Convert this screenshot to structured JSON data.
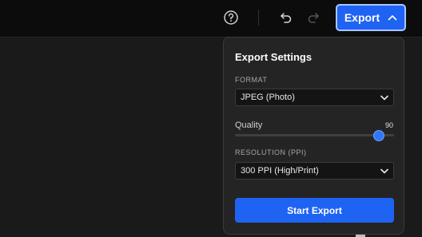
{
  "toolbar": {
    "export_label": "Export",
    "icons": [
      "help-icon",
      "undo-icon",
      "redo-icon",
      "chevron-up-icon"
    ]
  },
  "panel": {
    "title": "Export Settings",
    "format": {
      "label": "FORMAT",
      "value": "JPEG (Photo)"
    },
    "quality": {
      "label": "Quality",
      "value": "90",
      "level": 0.9
    },
    "resolution": {
      "label": "RESOLUTION (PPI)",
      "value": "300 PPI (High/Print)"
    },
    "start_label": "Start Export"
  },
  "colors": {
    "accent": "#1f63f3",
    "panel_bg": "#242424",
    "topbar_bg": "#0c0c0c",
    "canvas_bg": "#1a1a1a"
  }
}
